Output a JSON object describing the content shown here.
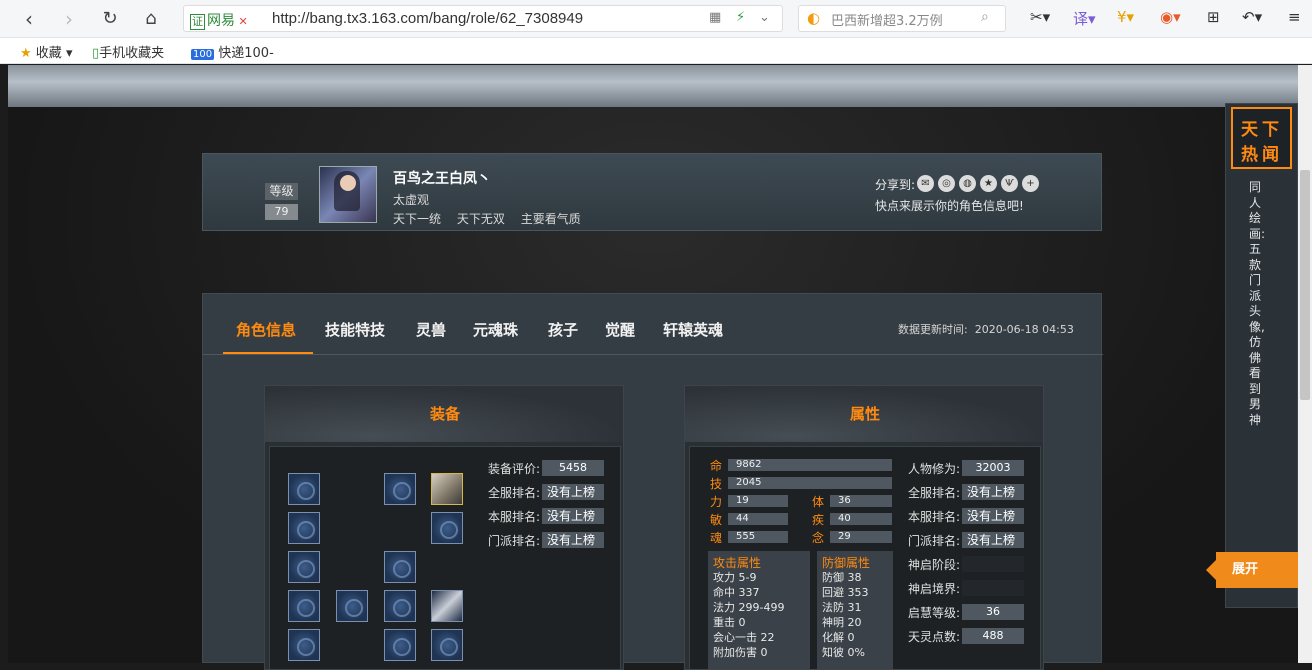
{
  "browser": {
    "url": "http://bang.tx3.163.com/bang/role/62_7308949",
    "cert_label": "证",
    "site_label": "网易",
    "search_placeholder": "巴西新增超3.2万例",
    "bookmarks": [
      "收藏",
      "手机收藏夹",
      "快递100"
    ]
  },
  "profile": {
    "level_label": "等级",
    "level": "79",
    "name": "百鸟之王白凤丶",
    "school": "太虚观",
    "tags": [
      "天下一统",
      "天下无双",
      "主要看气质"
    ],
    "share_label": "分享到:",
    "share_tip": "快点来展示你的角色信息吧!"
  },
  "tabs": [
    "角色信息",
    "技能特技",
    "灵兽",
    "元魂珠",
    "孩子",
    "觉醒",
    "轩辕英魂"
  ],
  "update_time_label": "数据更新时间:",
  "update_time": "2020-06-18 04:53",
  "equipment": {
    "title": "装备",
    "stats": [
      {
        "label": "装备评价:",
        "value": "5458"
      },
      {
        "label": "全服排名:",
        "value": "没有上榜"
      },
      {
        "label": "本服排名:",
        "value": "没有上榜"
      },
      {
        "label": "门派排名:",
        "value": "没有上榜"
      }
    ]
  },
  "attributes": {
    "title": "属性",
    "bars": [
      {
        "label": "命",
        "value": "9862"
      },
      {
        "label": "技",
        "value": "2045"
      }
    ],
    "pairs": [
      {
        "label": "力",
        "value": "19",
        "label2": "体",
        "value2": "36"
      },
      {
        "label": "敏",
        "value": "44",
        "label2": "疾",
        "value2": "40"
      },
      {
        "label": "魂",
        "value": "555",
        "label2": "念",
        "value2": "29"
      }
    ],
    "attack": {
      "title": "攻击属性",
      "rows": [
        "攻力  5-9",
        "命中  337",
        "法力  299-499",
        "重击  0",
        "会心一击  22",
        "附加伤害  0"
      ]
    },
    "defense": {
      "title": "防御属性",
      "rows": [
        "防御  38",
        "回避  353",
        "法防  31",
        "神明  20",
        "化解  0",
        "知彼  0%"
      ]
    },
    "right": [
      {
        "label": "人物修为:",
        "value": "32003"
      },
      {
        "label": "全服排名:",
        "value": "没有上榜"
      },
      {
        "label": "本服排名:",
        "value": "没有上榜"
      },
      {
        "label": "门派排名:",
        "value": "没有上榜"
      },
      {
        "label": "神启阶段:",
        "value": ""
      },
      {
        "label": "神启境界:",
        "value": ""
      },
      {
        "label": "启慧等级:",
        "value": "36"
      },
      {
        "label": "天灵点数:",
        "value": "488"
      }
    ]
  },
  "side": {
    "badge_line1": "天下",
    "badge_line2": "热闻",
    "text": "同人绘画:五款门派头像,仿佛看到男神",
    "expand": "展开"
  }
}
